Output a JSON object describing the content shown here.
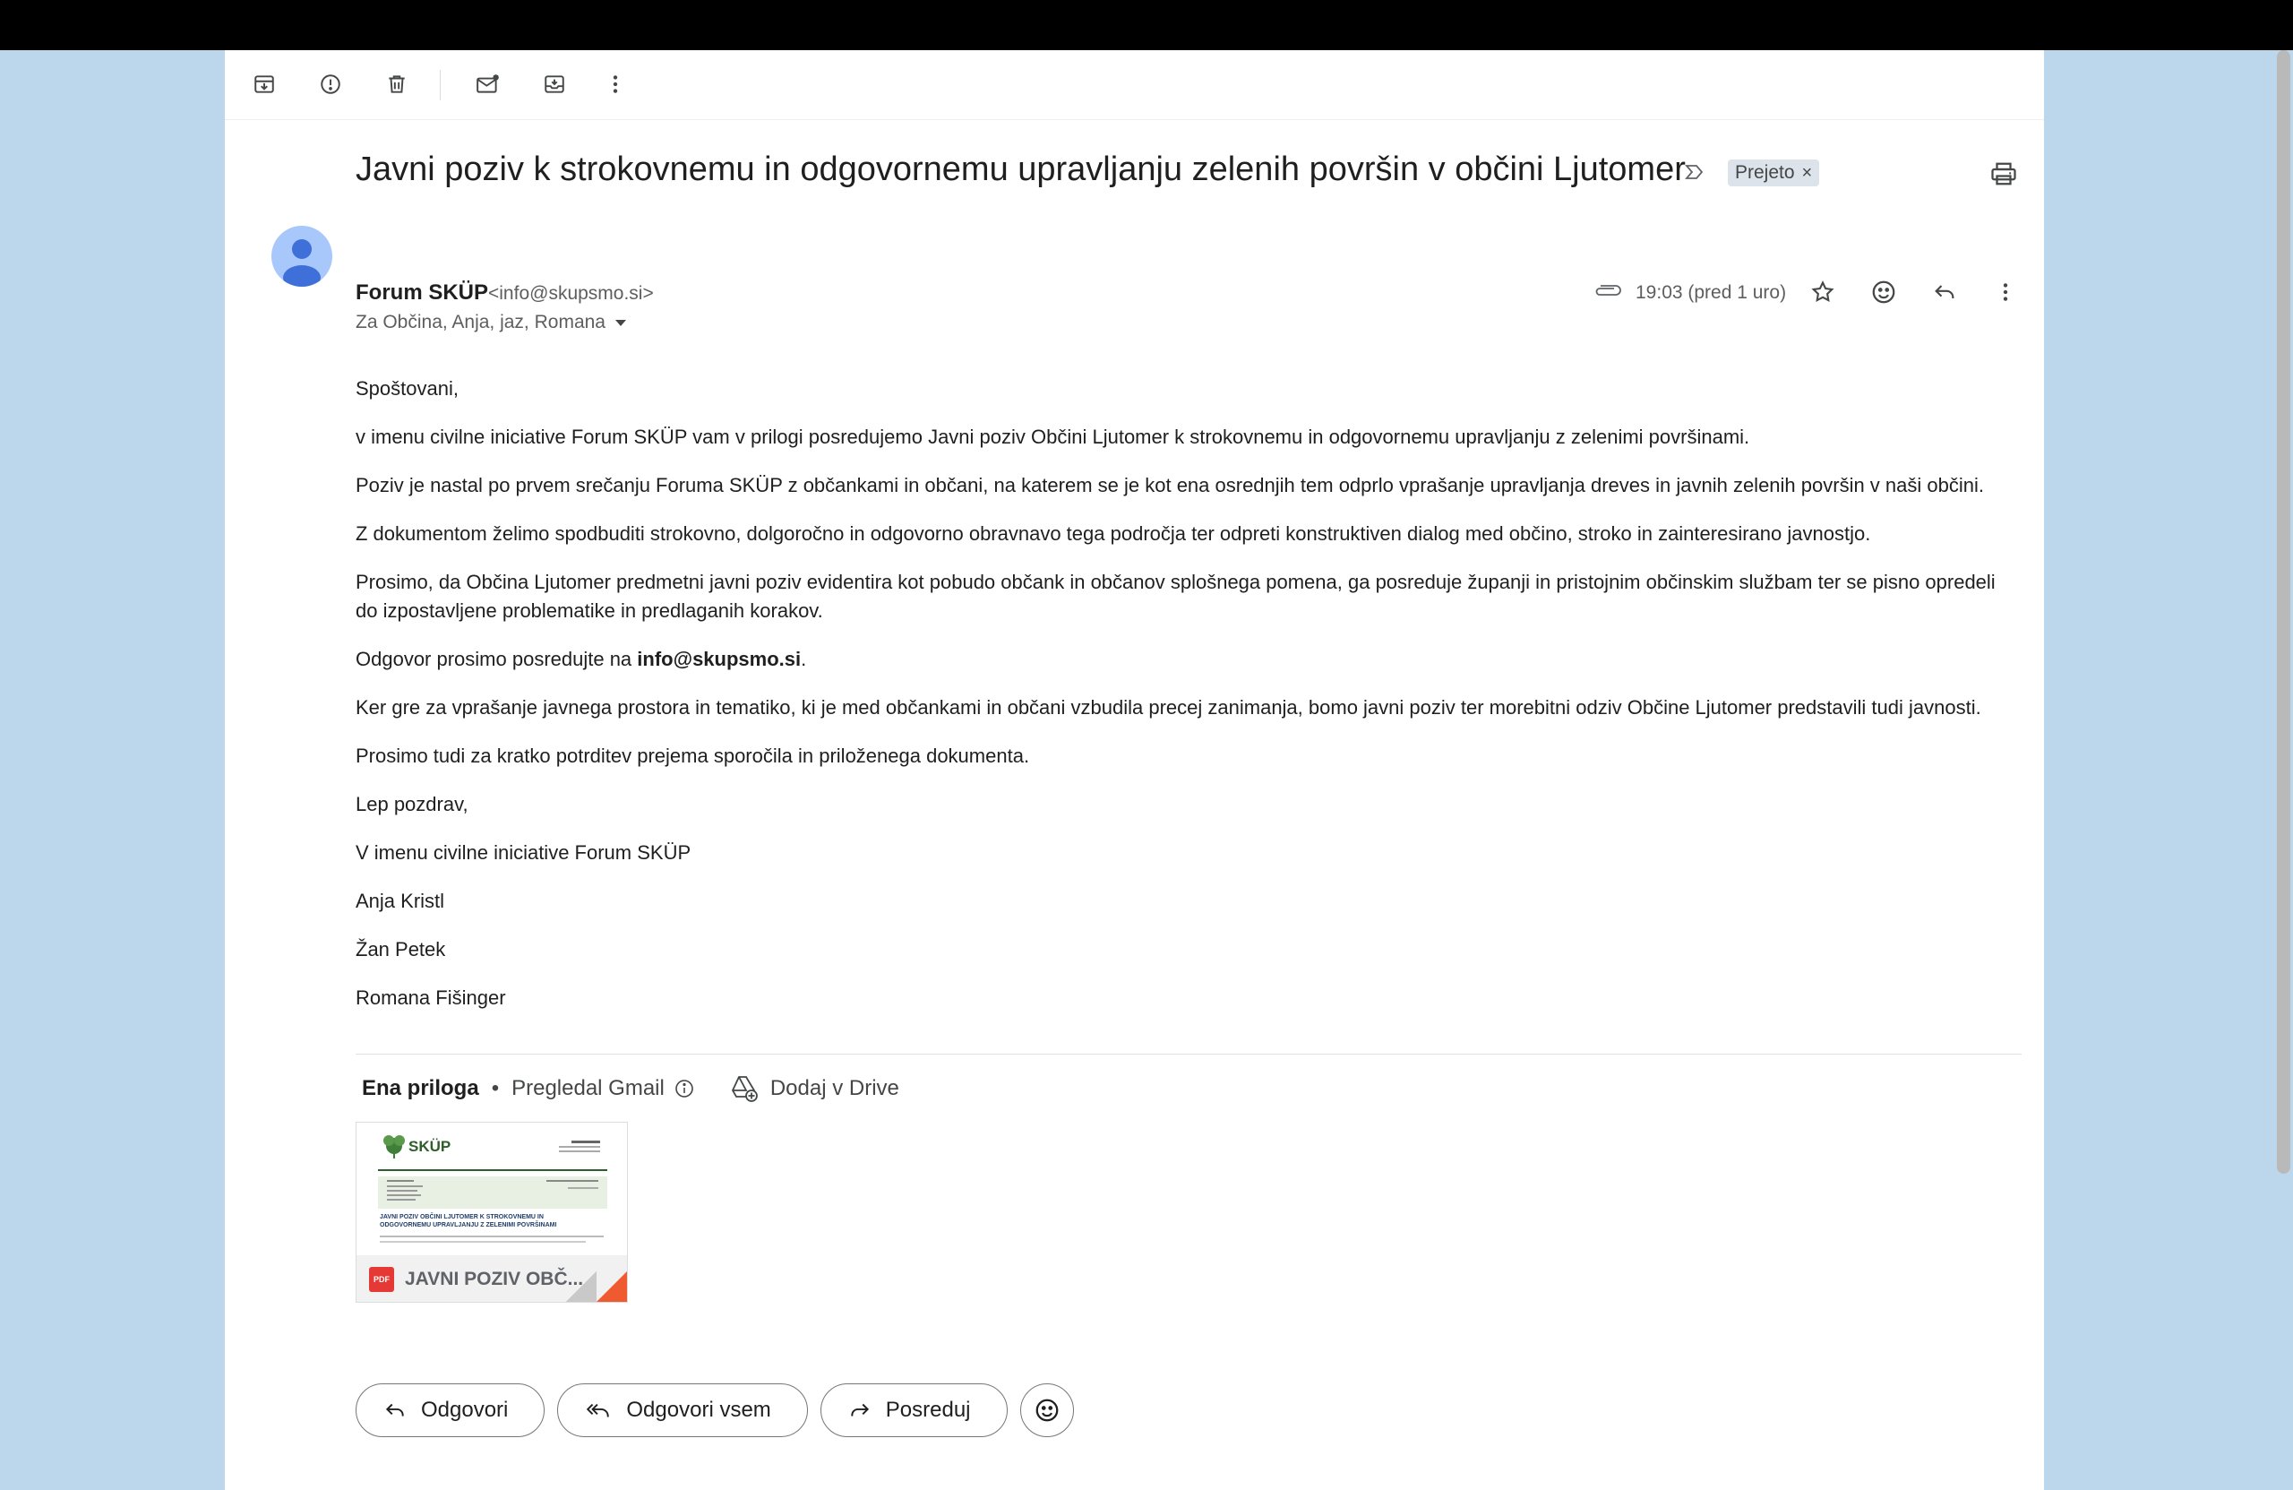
{
  "toolbar": {
    "icons": [
      "archive-icon",
      "report-spam-icon",
      "delete-icon",
      "mark-unread-icon",
      "move-to-icon",
      "more-vert-icon"
    ]
  },
  "email": {
    "subject": "Javni poziv k strokovnemu in odgovornemu upravljanju zelenih površin v občini Ljutomer",
    "label": "Prejeto",
    "label_remove": "×",
    "sender_name": "Forum SKÜP",
    "sender_email": "<info@skupsmo.si>",
    "recipients": "Za Občina, Anja, jaz, Romana",
    "timestamp": "19:03 (pred 1 uro)",
    "body": {
      "greeting": "Spoštovani,",
      "p1": "v imenu civilne iniciative Forum SKÜP vam v prilogi posredujemo Javni poziv Občini Ljutomer k strokovnemu in odgovornemu upravljanju z zelenimi površinami.",
      "p2": "Poziv je nastal po prvem srečanju Foruma SKÜP z občankami in občani, na katerem se je kot ena osrednjih tem odprlo vprašanje upravljanja dreves in javnih zelenih površin v naši občini.",
      "p3": "Z dokumentom želimo spodbuditi strokovno, dolgoročno in odgovorno obravnavo tega področja ter odpreti konstruktiven dialog med občino, stroko in zainteresirano javnostjo.",
      "p4": "Prosimo, da Občina Ljutomer predmetni javni poziv evidentira kot pobudo občank in občanov splošnega pomena, ga posreduje županji in pristojnim občinskim službam ter se pisno opredeli do izpostavljene problematike in predlaganih korakov.",
      "p5_prefix": "Odgovor prosimo posredujte na ",
      "p5_email": "info@skupsmo.si",
      "p5_suffix": ".",
      "p6": "Ker gre za vprašanje javnega prostora in tematiko, ki je med občankami in občani vzbudila precej zanimanja, bomo javni poziv ter morebitni odziv Občine Ljutomer predstavili tudi javnosti.",
      "p7": "Prosimo tudi za kratko potrditev prejema sporočila in priloženega dokumenta.",
      "closing": "Lep pozdrav,",
      "sign1": "V imenu civilne iniciative Forum SKÜP",
      "sign2": "Anja Kristl",
      "sign3": "Žan Petek",
      "sign4": "Romana Fišinger"
    }
  },
  "attachments": {
    "count_label": "Ena priloga",
    "separator": "•",
    "scanned_label": "Pregledal Gmail",
    "add_drive_label": "Dodaj v Drive",
    "file": {
      "type_badge": "PDF",
      "name": "JAVNI POZIV OBČ...",
      "preview_logo": "SKÜP",
      "preview_title_line1": "JAVNI POZIV OBČINI LJUTOMER K STROKOVNEMU IN",
      "preview_title_line2": "ODGOVORNEMU UPRAVLJANJU Z ZELENIMI POVRŠINAMI"
    }
  },
  "actions": {
    "reply": "Odgovori",
    "reply_all": "Odgovori vsem",
    "forward": "Posreduj"
  },
  "colors": {
    "background": "#bcd6ec",
    "avatar": "#a8c7fa",
    "avatar_figure": "#3f6fd8",
    "pdf_red": "#e53935",
    "label_chip": "#dde3ea"
  }
}
